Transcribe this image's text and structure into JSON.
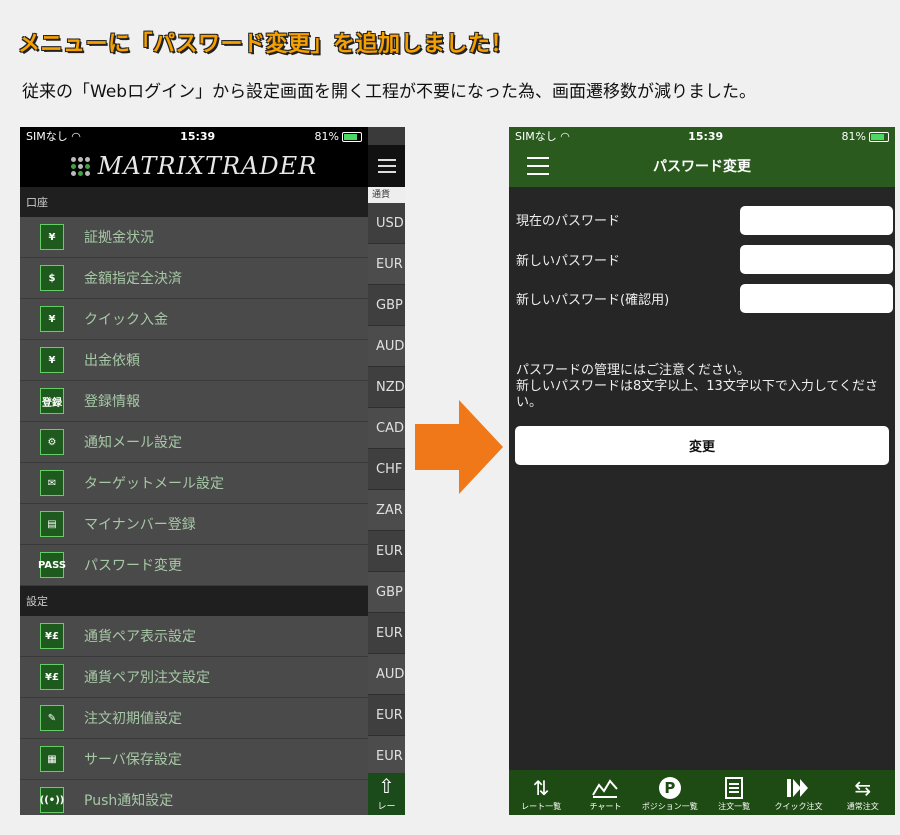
{
  "headline": "メニューに「パスワード変更」を追加しました！",
  "subtext": "従来の「Webログイン」から設定画面を開く工程が不要になった為、画面遷移数が減りました。",
  "left_phone": {
    "status": {
      "carrier": "SIMなし",
      "time": "15:39",
      "battery": "81%"
    },
    "logo": "MATRIXTRADER",
    "sections": [
      {
        "title": "口座",
        "items": [
          {
            "label": "証拠金状況",
            "icon": "¥"
          },
          {
            "label": "金額指定全決済",
            "icon": "$"
          },
          {
            "label": "クイック入金",
            "icon": "¥"
          },
          {
            "label": "出金依頼",
            "icon": "¥"
          },
          {
            "label": "登録情報",
            "icon": "登録"
          },
          {
            "label": "通知メール設定",
            "icon": "⚙"
          },
          {
            "label": "ターゲットメール設定",
            "icon": "✉"
          },
          {
            "label": "マイナンバー登録",
            "icon": "▤"
          },
          {
            "label": "パスワード変更",
            "icon": "PASS"
          }
        ]
      },
      {
        "title": "設定",
        "items": [
          {
            "label": "通貨ペア表示設定",
            "icon": "¥£"
          },
          {
            "label": "通貨ペア別注文設定",
            "icon": "¥£"
          },
          {
            "label": "注文初期値設定",
            "icon": "✎"
          },
          {
            "label": "サーバ保存設定",
            "icon": "▦"
          },
          {
            "label": "Push通知設定",
            "icon": "((•))"
          }
        ]
      }
    ],
    "side": {
      "header": "通貨",
      "cells": [
        "USD",
        "EUR",
        "GBP",
        "AUD",
        "NZD",
        "CAD",
        "CHF",
        "ZAR",
        "EUR",
        "GBP",
        "EUR",
        "AUD",
        "EUR",
        "EUR"
      ],
      "bottom_label": "レー"
    }
  },
  "right_phone": {
    "status": {
      "carrier": "SIMなし",
      "time": "15:39",
      "battery": "81%"
    },
    "title": "パスワード変更",
    "fields": [
      {
        "label": "現在のパスワード",
        "value": ""
      },
      {
        "label": "新しいパスワード",
        "value": ""
      },
      {
        "label": "新しいパスワード(確認用)",
        "value": ""
      }
    ],
    "notice": "パスワードの管理にはご注意ください。\n新しいパスワードは8文字以上、13文字以下で入力してください。",
    "button": "変更",
    "tabs": [
      {
        "label": "レート一覧",
        "icon": "arrows-updown-icon"
      },
      {
        "label": "チャート",
        "icon": "chart-icon"
      },
      {
        "label": "ポジション一覧",
        "icon": "position-icon"
      },
      {
        "label": "注文一覧",
        "icon": "order-list-icon"
      },
      {
        "label": "クイック注文",
        "icon": "quick-order-icon"
      },
      {
        "label": "通常注文",
        "icon": "normal-order-icon"
      }
    ]
  },
  "colors": {
    "headline": "#f5a000",
    "header_green": "#2a5a1e",
    "arrow": "#f07818"
  }
}
